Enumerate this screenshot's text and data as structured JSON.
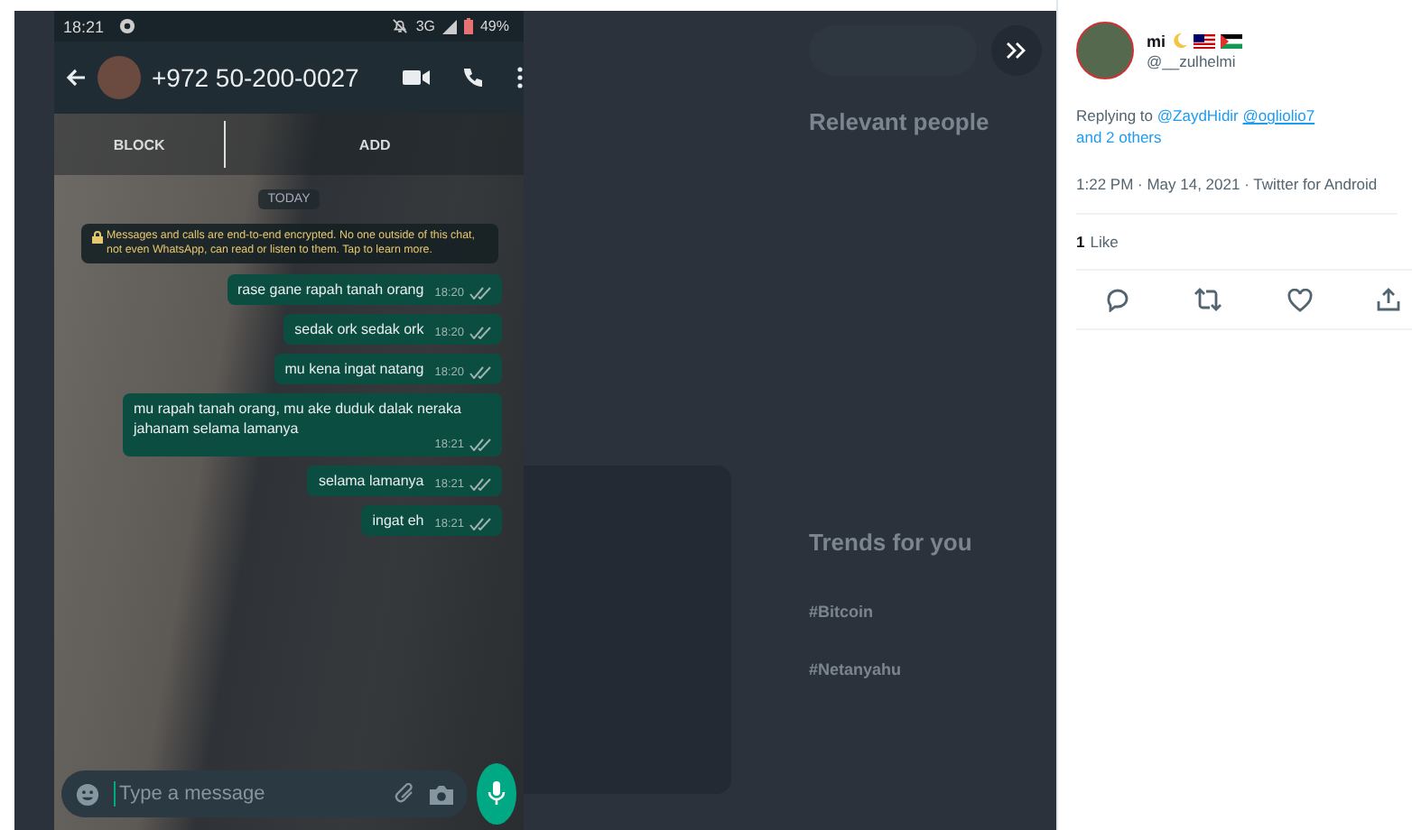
{
  "phone": {
    "status_bar": {
      "time": "18:21",
      "network": "3G",
      "battery": "49%"
    },
    "header": {
      "contact": "+972 50-200-0027"
    },
    "actions": [
      "BLOCK",
      "ADD"
    ],
    "date_label": "TODAY",
    "notice": "Messages and calls are end-to-end encrypted. No one outside of this chat, not even WhatsApp, can read or listen to them. Tap to learn more.",
    "messages": [
      {
        "text": "rase gane rapah tanah orang",
        "time": "18:20"
      },
      {
        "text": "sedak ork sedak ork",
        "time": "18:20"
      },
      {
        "text": "mu kena ingat natang",
        "time": "18:20"
      },
      {
        "text": "mu rapah tanah orang, mu ake duduk dalak neraka jahanam selama lamanya",
        "time": "18:21"
      },
      {
        "text": "selama lamanya",
        "time": "18:21"
      },
      {
        "text": "ingat eh",
        "time": "18:21"
      }
    ],
    "input": {
      "placeholder": "Type a message"
    }
  },
  "background_page": {
    "sections": [
      {
        "title": "Relevant people"
      },
      {
        "title": "Trends for you",
        "items": [
          "#Bitcoin",
          "#Netanyahu"
        ]
      }
    ]
  },
  "tweet": {
    "name": "mi",
    "handle": "@__zulhelmi",
    "replying": {
      "prefix": "Replying to",
      "mentions": [
        "@ZaydHidir",
        "@ogliolio7"
      ],
      "others": "and 2 others"
    },
    "meta": "1:22 PM · May 14, 2021 · Twitter for Android",
    "likes": {
      "count": "1",
      "label": "Like"
    }
  }
}
